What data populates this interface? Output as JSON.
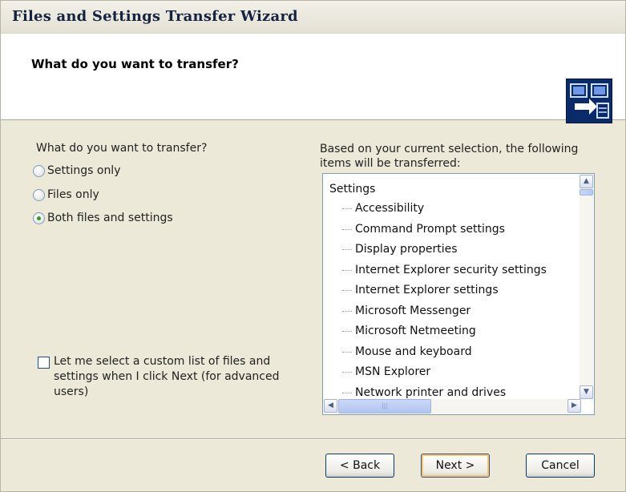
{
  "window": {
    "title": "Files and Settings Transfer Wizard"
  },
  "header": {
    "heading": "What do you want to transfer?",
    "icon": "transfer-wizard-icon"
  },
  "left": {
    "question": "What do you want to transfer?",
    "options": [
      {
        "label": "Settings only",
        "checked": false
      },
      {
        "label": "Files only",
        "checked": false
      },
      {
        "label": "Both files and settings",
        "checked": true
      }
    ],
    "custom_list_label": "Let me select a custom list of files and settings when I click Next (for advanced users)",
    "custom_list_checked": false
  },
  "right": {
    "description": "Based on your current selection, the following items will be transferred:",
    "tree_root": "Settings",
    "items": [
      "Accessibility",
      "Command Prompt settings",
      "Display properties",
      "Internet Explorer security settings",
      "Internet Explorer settings",
      "Microsoft Messenger",
      "Microsoft Netmeeting",
      "Mouse and keyboard",
      "MSN Explorer",
      "Network printer and drives"
    ]
  },
  "buttons": {
    "back": "< Back",
    "next": "Next >",
    "cancel": "Cancel"
  }
}
